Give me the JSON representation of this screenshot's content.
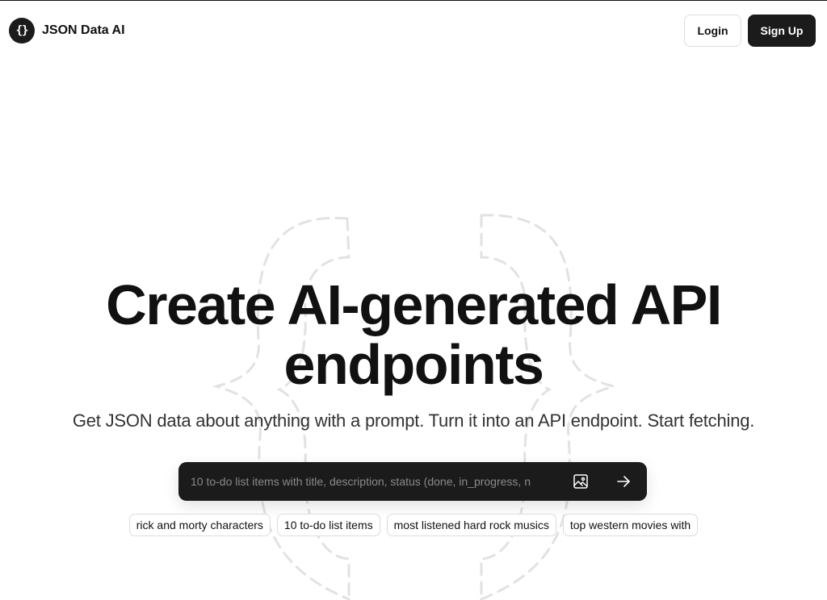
{
  "header": {
    "logo_icon": "curly-braces-icon",
    "logo_glyph": "{}",
    "brand_name": "JSON Data AI",
    "login_label": "Login",
    "signup_label": "Sign Up"
  },
  "hero": {
    "title": "Create AI-generated API endpoints",
    "subtitle": "Get JSON data about anything with a prompt. Turn it into an API endpoint. Start fetching."
  },
  "prompt": {
    "placeholder": "10 to-do list items with title, description, status (done, in_progress, n",
    "value": "",
    "image_icon": "image-upload-icon",
    "send_icon": "arrow-right-icon"
  },
  "suggestions": [
    "rick and morty characters",
    "10 to-do list items",
    "most listened hard rock musics",
    "top western movies with"
  ],
  "colors": {
    "dark": "#1b1b1b",
    "text": "#111111",
    "border": "#dcdcdc",
    "bg_art": "#e2e2e2"
  }
}
